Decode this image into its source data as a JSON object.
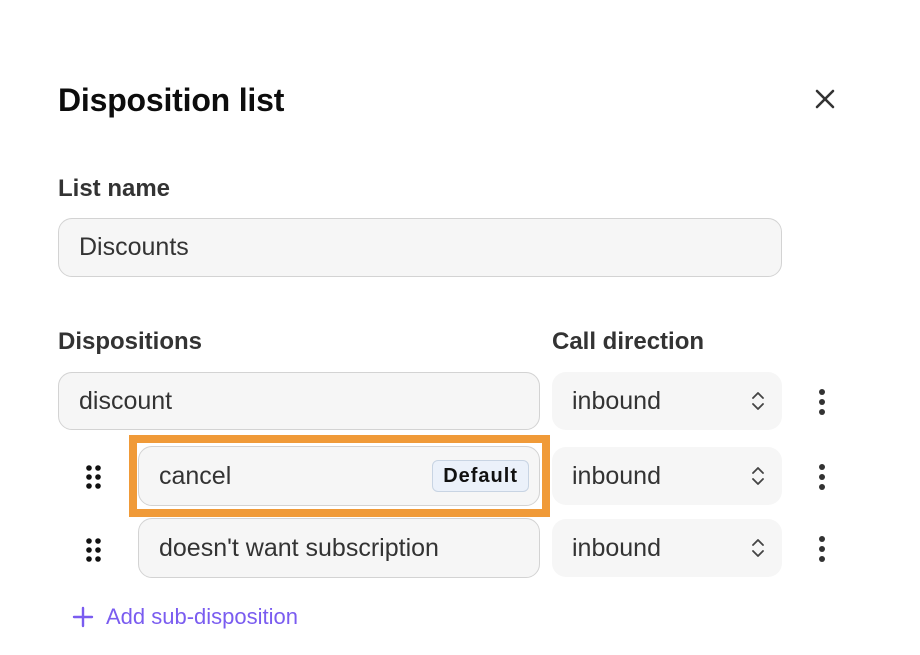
{
  "dialog": {
    "title": "Disposition list",
    "close_icon": "close-icon"
  },
  "list_name": {
    "label": "List name",
    "value": "Discounts"
  },
  "dispositions": {
    "label": "Dispositions",
    "call_direction_label": "Call direction",
    "parent": {
      "name": "discount",
      "call_direction": "inbound"
    },
    "sub_dispositions": [
      {
        "name": "cancel",
        "badge": "Default",
        "call_direction": "inbound",
        "highlighted": true
      },
      {
        "name": "doesn't want subscription",
        "call_direction": "inbound",
        "highlighted": false
      }
    ],
    "add_sub_label": "Add sub-disposition"
  },
  "colors": {
    "accent": "#7a5cf0",
    "highlight": "#f09a38",
    "input_bg": "#f6f6f6",
    "badge_bg": "#ebf1fa"
  }
}
